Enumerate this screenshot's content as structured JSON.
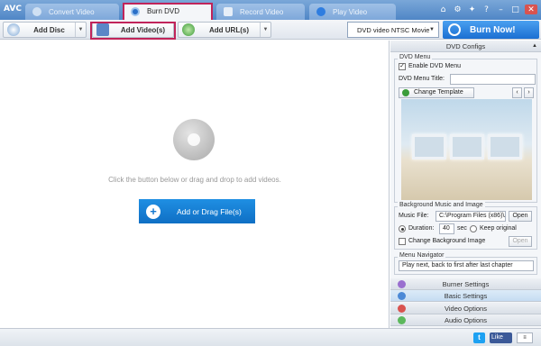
{
  "app": {
    "logo": "AVC"
  },
  "tabs": [
    {
      "label": "Convert Video",
      "active": false
    },
    {
      "label": "Burn DVD",
      "active": true
    },
    {
      "label": "Record Video",
      "active": false
    },
    {
      "label": "Play Video",
      "active": false
    }
  ],
  "toolbar": {
    "add_disc": "Add Disc",
    "add_videos": "Add Video(s)",
    "add_urls": "Add URL(s)",
    "format": "DVD video NTSC Movie",
    "burn_now": "Burn Now!"
  },
  "main": {
    "hint": "Click the button below or drag and drop to add videos.",
    "add_button": "Add or Drag File(s)"
  },
  "panel": {
    "dvd_configs": "DVD Configs",
    "dvd_menu_group": "DVD Menu",
    "enable_dvd_menu": "Enable DVD Menu",
    "menu_title_label": "DVD Menu Title:",
    "menu_title_value": "",
    "change_template": "Change Template",
    "bg_group": "Background Music and Image",
    "music_file_label": "Music File:",
    "music_file_value": "C:\\Program Files (x86)\\A",
    "open": "Open",
    "duration_label": "Duration:",
    "duration_value": "40",
    "sec": "sec",
    "keep_original": "Keep original",
    "change_bg_image": "Change Background Image",
    "open2": "Open",
    "menu_nav_group": "Menu Navigator",
    "menu_nav_value": "Play next, back to first after last chapter",
    "burner_settings": "Burner Settings",
    "basic_settings": "Basic Settings",
    "video_options": "Video Options",
    "audio_options": "Audio Options"
  },
  "status": {
    "twitter": "t",
    "facebook": "Like"
  },
  "colors": {
    "accent": "#1b6fd2",
    "highlight": "#c0245a"
  }
}
